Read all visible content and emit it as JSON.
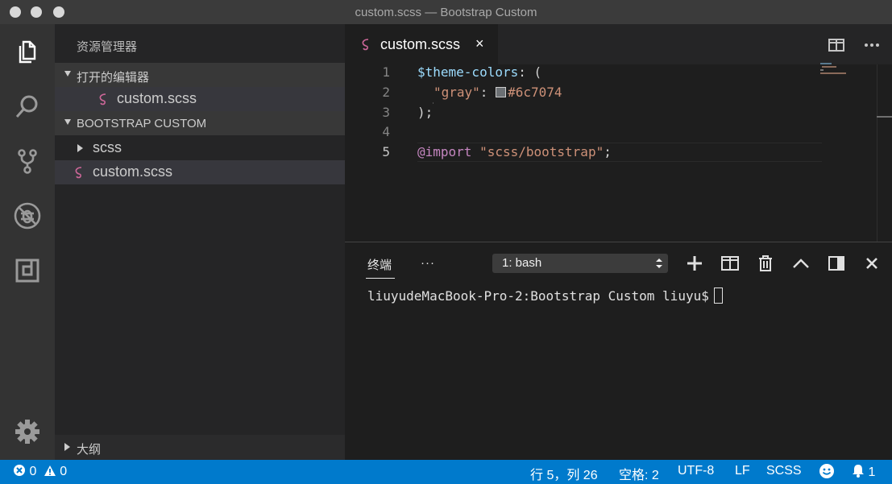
{
  "window": {
    "title": "custom.scss — Bootstrap Custom"
  },
  "sidebar": {
    "title": "资源管理器",
    "open_editors": {
      "label": "打开的编辑器",
      "files": [
        "custom.scss"
      ]
    },
    "workspace": {
      "label": "BOOTSTRAP CUSTOM",
      "folder": "scss",
      "file": "custom.scss"
    },
    "outline": {
      "label": "大纲"
    }
  },
  "editor": {
    "tab_label": "custom.scss",
    "tab_close": "×",
    "line_numbers": [
      "1",
      "2",
      "3",
      "4",
      "5"
    ],
    "lines": {
      "l1": {
        "var": "$theme-colors",
        "rest": ": ("
      },
      "l2": {
        "key": "\"gray\"",
        "colon": ": ",
        "color": "#6c7074"
      },
      "l3": {
        "text": ");"
      },
      "l5": {
        "kw": "@import",
        "space": " ",
        "str": "\"scss/bootstrap\"",
        "end": ";"
      }
    },
    "swatch_color": "#6c7074"
  },
  "panel": {
    "tab": "终端",
    "more": "···",
    "terminal_select": "1: bash",
    "prompt": "liuyudeMacBook-Pro-2:Bootstrap Custom liuyu$"
  },
  "statusbar": {
    "errors": "0",
    "warnings": "0",
    "position": "行 5，列 26",
    "spaces": "空格: 2",
    "encoding": "UTF-8",
    "eol": "LF",
    "language": "SCSS",
    "notifications": "1"
  },
  "colors": {
    "accent": "#007acc",
    "sass_pink": "#cd6799"
  }
}
